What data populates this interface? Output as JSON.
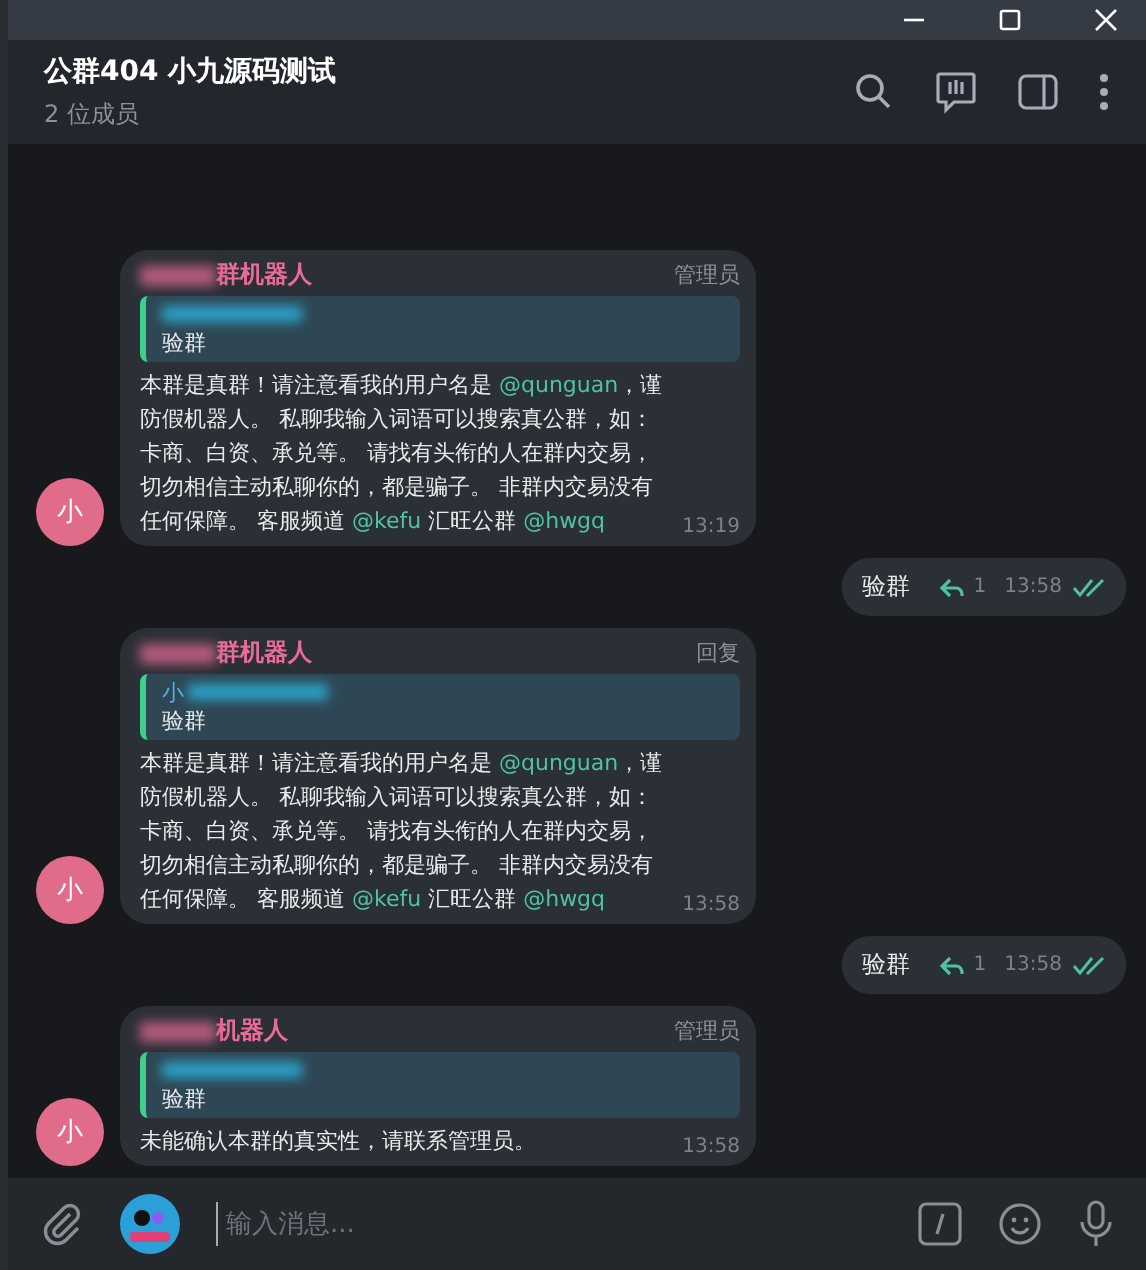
{
  "header": {
    "title": "公群404 小九源码测试",
    "subtitle": "2 位成员"
  },
  "messages": [
    {
      "kind": "incoming",
      "avatar": "小",
      "sender": "群机器人",
      "tag": "管理员",
      "quote": {
        "text": "验群"
      },
      "body": [
        {
          "kind": "text",
          "text": "本群是真群！请注意看我的用户名是 "
        },
        {
          "kind": "mention",
          "text": "@qunguan"
        },
        {
          "kind": "text",
          "text": "，谨防假机器人。 私聊我输入词语可以搜索真公群，如：卡商、白资、承兑等。 请找有头衔的人在群内交易，切勿相信主动私聊你的，都是骗子。 非群内交易没有任何保障。 客服频道 "
        },
        {
          "kind": "mention",
          "text": "@kefu"
        },
        {
          "kind": "text",
          "text": " 汇旺公群 "
        },
        {
          "kind": "mention",
          "text": "@hwgq"
        }
      ],
      "time": "13:19"
    },
    {
      "kind": "outgoing",
      "text": "验群",
      "replies": "1",
      "time": "13:58",
      "read": true
    },
    {
      "kind": "incoming",
      "avatar": "小",
      "sender": "群机器人",
      "tag": "回复",
      "quote": {
        "name": "小",
        "text": "验群"
      },
      "body": [
        {
          "kind": "text",
          "text": "本群是真群！请注意看我的用户名是 "
        },
        {
          "kind": "mention",
          "text": "@qunguan"
        },
        {
          "kind": "text",
          "text": "，谨防假机器人。 私聊我输入词语可以搜索真公群，如：卡商、白资、承兑等。 请找有头衔的人在群内交易，切勿相信主动私聊你的，都是骗子。 非群内交易没有任何保障。 客服频道 "
        },
        {
          "kind": "mention",
          "text": "@kefu"
        },
        {
          "kind": "text",
          "text": " 汇旺公群 "
        },
        {
          "kind": "mention",
          "text": "@hwgq"
        }
      ],
      "time": "13:58"
    },
    {
      "kind": "outgoing",
      "text": "验群",
      "replies": "1",
      "time": "13:58",
      "read": true
    },
    {
      "kind": "incoming",
      "avatar": "小",
      "sender": "机器人",
      "tag": "管理员",
      "quote": {
        "text": "验群"
      },
      "body": [
        {
          "kind": "text",
          "text": "未能确认本群的真实性，请联系管理员。"
        }
      ],
      "time": "13:58"
    }
  ],
  "composer": {
    "placeholder": "输入消息..."
  }
}
